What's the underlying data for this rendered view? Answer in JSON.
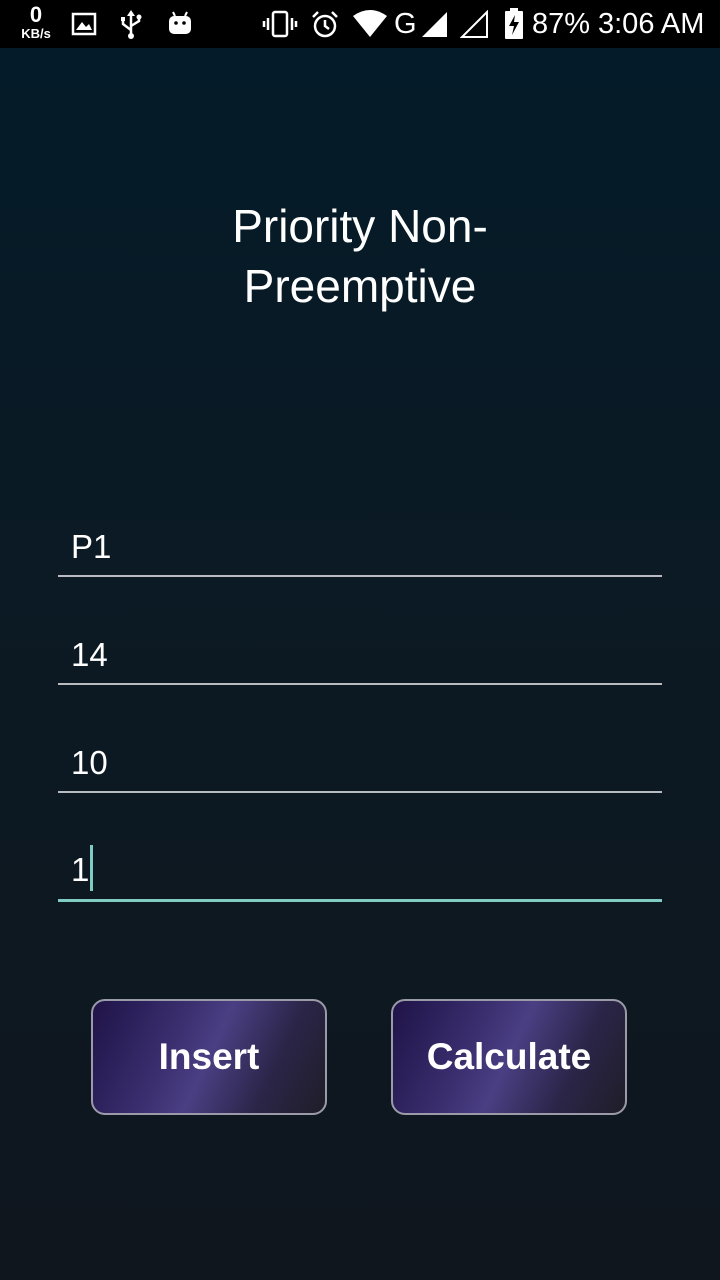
{
  "status_bar": {
    "net_speed_value": "0",
    "net_speed_unit": "KB/s",
    "network_label": "G",
    "battery": "87%",
    "time": "3:06 AM"
  },
  "screen": {
    "title_line1": "Priority Non-",
    "title_line2": "Preemptive"
  },
  "form": {
    "fields": [
      {
        "value": "P1"
      },
      {
        "value": "14"
      },
      {
        "value": "10"
      },
      {
        "value": "1"
      }
    ]
  },
  "actions": {
    "insert_label": "Insert",
    "calculate_label": "Calculate"
  },
  "colors": {
    "accent": "#80cbc4",
    "button_gradient_mid": "#4a3f83"
  }
}
